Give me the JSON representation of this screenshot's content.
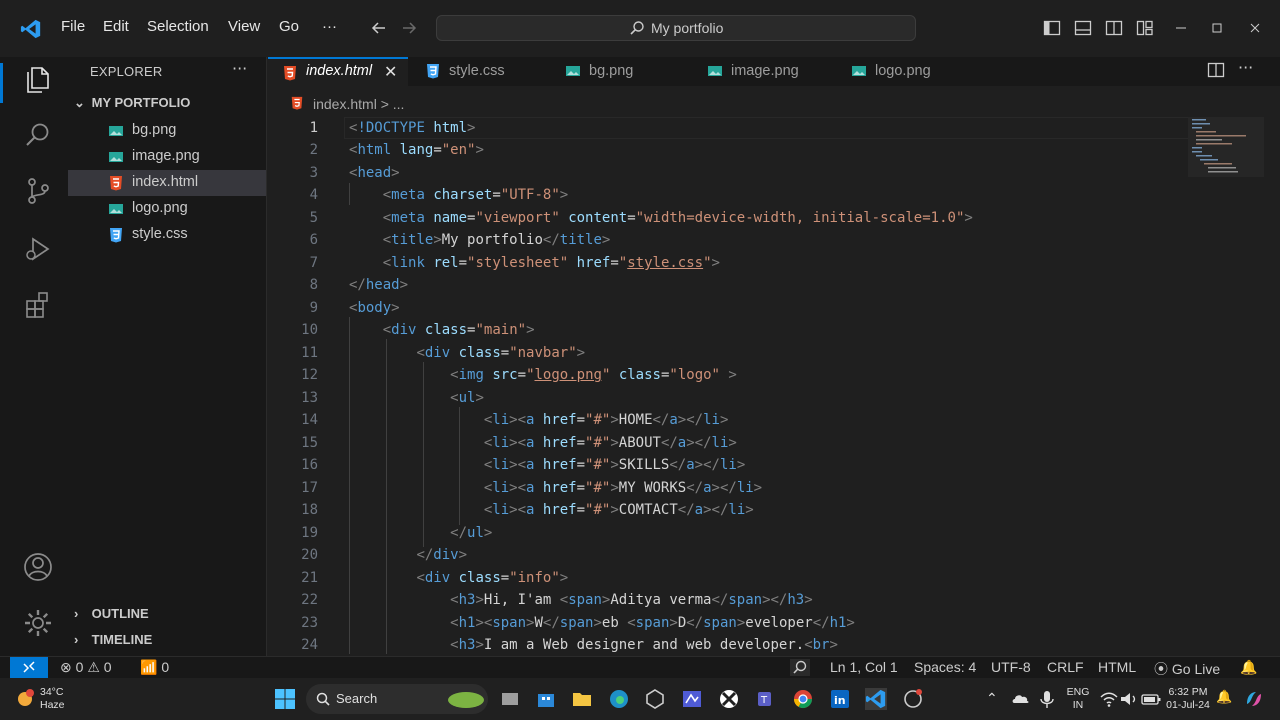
{
  "menu": [
    "File",
    "Edit",
    "Selection",
    "View",
    "Go",
    "···"
  ],
  "command_center": {
    "label": "My portfolio"
  },
  "colors": {
    "accent": "#0078d4",
    "html_icon": "#e44d26",
    "css_icon": "#42a5f5",
    "image_icon": "#26a69a"
  },
  "sidebar": {
    "title": "EXPLORER",
    "more": "···",
    "folder": "MY PORTFOLIO",
    "files": [
      {
        "name": "bg.png",
        "icon": "image-icon"
      },
      {
        "name": "image.png",
        "icon": "image-icon"
      },
      {
        "name": "index.html",
        "icon": "html-icon",
        "active": true
      },
      {
        "name": "logo.png",
        "icon": "image-icon"
      },
      {
        "name": "style.css",
        "icon": "css-icon"
      }
    ],
    "outline": "OUTLINE",
    "timeline": "TIMELINE"
  },
  "tabs": [
    {
      "name": "index.html",
      "icon": "html-icon",
      "active": true,
      "close": "✕"
    },
    {
      "name": "style.css",
      "icon": "css-icon"
    },
    {
      "name": "bg.png",
      "icon": "image-icon"
    },
    {
      "name": "image.png",
      "icon": "image-icon"
    },
    {
      "name": "logo.png",
      "icon": "image-icon"
    }
  ],
  "tabs_more": "···",
  "breadcrumb": {
    "file": "index.html",
    "rest": "> ..."
  },
  "code": {
    "line_numbers": [
      "1",
      "2",
      "3",
      "4",
      "5",
      "6",
      "7",
      "8",
      "9",
      "10",
      "11",
      "12",
      "13",
      "14",
      "15",
      "16",
      "17",
      "18",
      "19",
      "20",
      "21",
      "22",
      "23",
      "24"
    ],
    "current_line": 1
  },
  "status": {
    "errors": "0",
    "warnings": "0",
    "ports": "0",
    "position": "Ln 1, Col 1",
    "spaces": "Spaces: 4",
    "encoding": "UTF-8",
    "eol": "CRLF",
    "language": "HTML",
    "golive": "Go Live"
  },
  "taskbar": {
    "weather_temp": "34°C",
    "weather_desc": "Haze",
    "search": "Search",
    "lang1": "ENG",
    "lang2": "IN",
    "time": "6:32 PM",
    "date": "01-Jul-24"
  }
}
